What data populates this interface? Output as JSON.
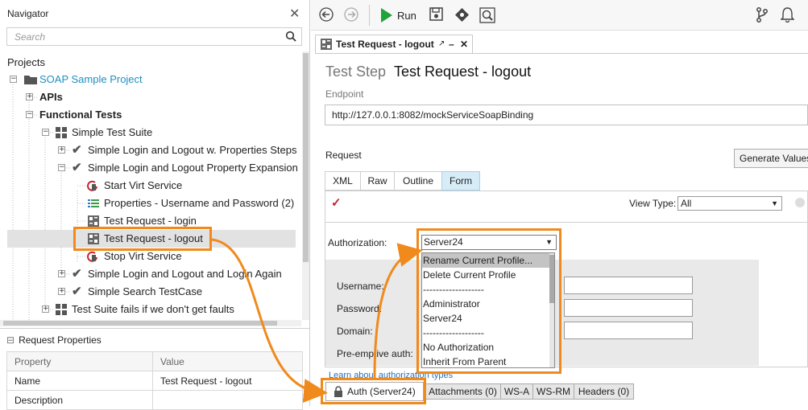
{
  "navigator": {
    "title": "Navigator",
    "search_placeholder": "Search",
    "projects_label": "Projects",
    "tree": [
      {
        "label": "SOAP Sample Project",
        "icon": "folder-icon"
      },
      {
        "label": "APIs"
      },
      {
        "label": "Functional Tests"
      },
      {
        "label": "Simple Test Suite",
        "icon": "test-suite-icon"
      },
      {
        "label": "Simple Login and Logout w. Properties Steps",
        "icon": "test-case-check-icon"
      },
      {
        "label": "Simple Login and Logout Property Expansion",
        "icon": "test-case-check-icon"
      },
      {
        "label": "Start Virt Service",
        "icon": "virt-service-icon"
      },
      {
        "label": "Properties - Username and Password (2)",
        "icon": "properties-icon"
      },
      {
        "label": "Test Request - login",
        "icon": "soap-request-icon"
      },
      {
        "label": "Test Request - logout",
        "icon": "soap-request-icon"
      },
      {
        "label": "Stop Virt Service",
        "icon": "virt-service-icon"
      },
      {
        "label": "Simple Login and Logout and Login Again",
        "icon": "test-case-check-icon"
      },
      {
        "label": "Simple Search TestCase",
        "icon": "test-case-check-icon"
      },
      {
        "label": "Test Suite fails if we don't get faults",
        "icon": "test-suite-icon"
      }
    ]
  },
  "request_properties": {
    "title": "Request Properties",
    "headers": [
      "Property",
      "Value"
    ],
    "rows": [
      [
        "Name",
        "Test Request - logout"
      ],
      [
        "Description",
        ""
      ]
    ]
  },
  "toolbar": {
    "run_label": "Run"
  },
  "editor": {
    "tab_title": "Test Request - logout",
    "step_type": "Test Step",
    "step_name": "Test Request - logout",
    "endpoint_label": "Endpoint",
    "endpoint_value": "http://127.0.0.1:8082/mockServiceSoapBinding",
    "request_label": "Request",
    "generate_button": "Generate Values",
    "request_tabs": [
      "XML",
      "Raw",
      "Outline",
      "Form"
    ],
    "active_request_tab": "Form",
    "view_type_label": "View Type:",
    "view_type_value": "All",
    "authorization_label": "Authorization:",
    "authorization_value": "Server24",
    "fields": [
      "Username:",
      "Password:",
      "Domain:",
      "Pre-emptive auth:"
    ],
    "dropdown_options": [
      "Rename Current Profile...",
      "Delete Current Profile",
      "-------------------",
      "Administrator",
      "Server24",
      "-------------------",
      "No Authorization",
      "Inherit From Parent"
    ],
    "learn_link": "Learn about authorization types",
    "bottom_tabs": [
      "Auth (Server24)",
      "Attachments (0)",
      "WS-A",
      "WS-RM",
      "Headers (0)"
    ]
  },
  "colors": {
    "highlight": "#f08a1c",
    "active_tab": "#d6edf8",
    "project_text": "#1f8fbf",
    "run_green": "#1fa33a"
  }
}
